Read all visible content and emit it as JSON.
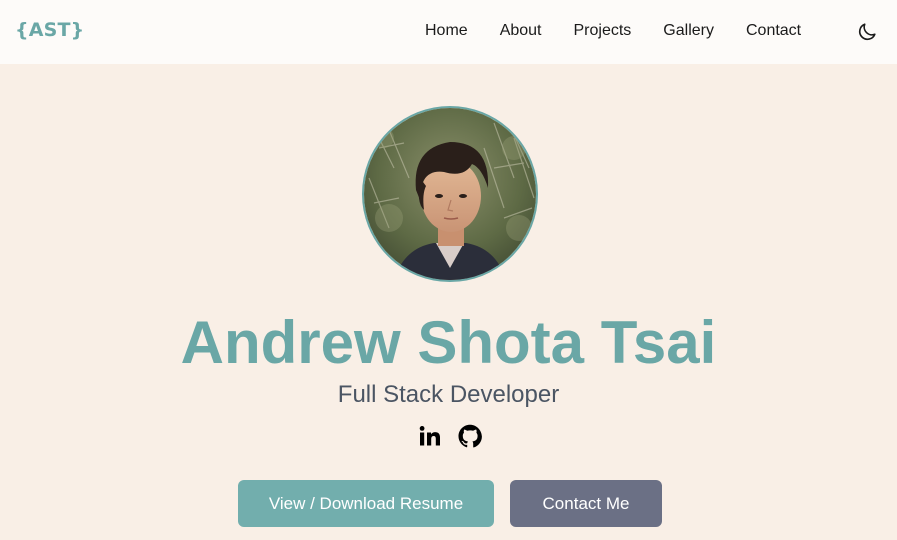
{
  "navbar": {
    "logo": "{AST}",
    "links": [
      {
        "label": "Home"
      },
      {
        "label": "About"
      },
      {
        "label": "Projects"
      },
      {
        "label": "Gallery"
      },
      {
        "label": "Contact"
      }
    ],
    "theme_toggle_icon": "moon-icon"
  },
  "hero": {
    "avatar_icon": "profile-photo",
    "name": "Andrew Shota Tsai",
    "role": "Full Stack Developer",
    "socials": [
      {
        "icon": "linkedin-icon"
      },
      {
        "icon": "github-icon"
      }
    ],
    "buttons": {
      "resume": "View / Download Resume",
      "contact": "Contact Me"
    }
  },
  "colors": {
    "accent": "#6aa7a6",
    "page_background": "#f9efe6",
    "navbar_background": "#fdfbf9",
    "resume_button": "#72aead",
    "contact_button": "#6b7085",
    "subtitle_text": "#4b5563"
  }
}
